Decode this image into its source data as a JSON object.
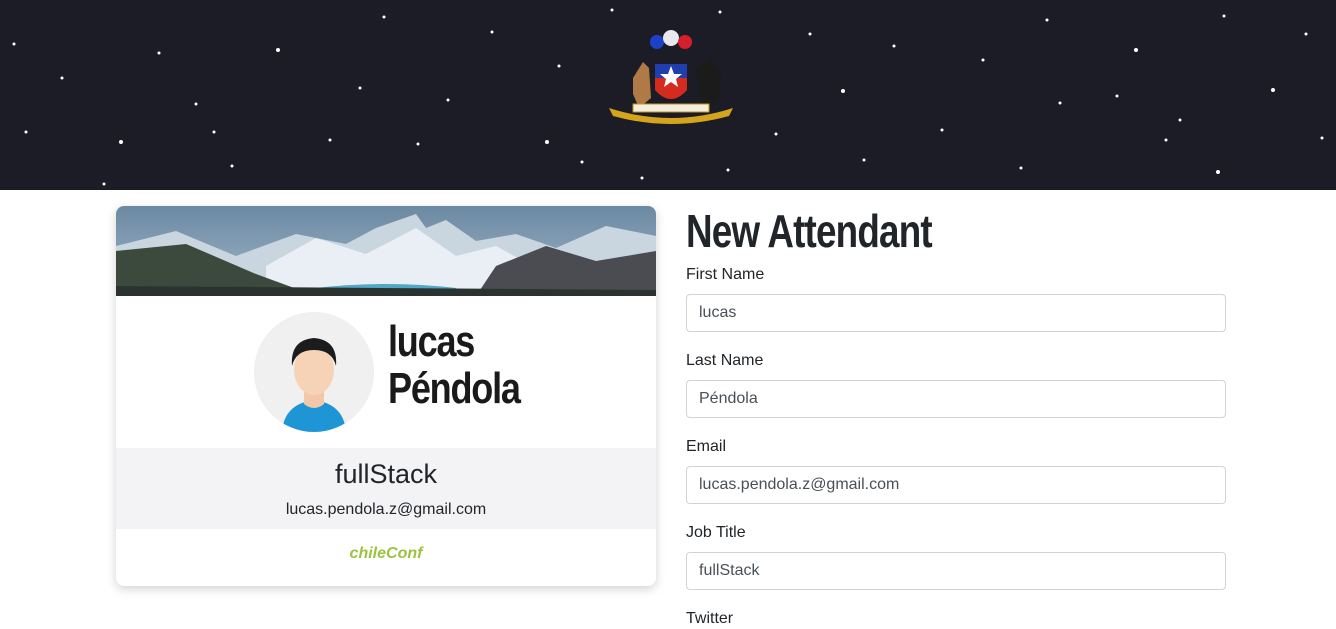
{
  "colors": {
    "header_bg": "#1c1c26",
    "event_accent": "#9ac440",
    "info_band": "#f3f3f5",
    "input_border": "#ced4da"
  },
  "header": {
    "logo_icon": "chile-coat-of-arms-icon"
  },
  "badge": {
    "banner_icon": "mountain-landscape-image",
    "avatar_icon": "user-avatar-icon",
    "first_name": "lucas",
    "last_name": "Péndola",
    "job_title": "fullStack",
    "email": "lucas.pendola.z@gmail.com",
    "event": "chileConf"
  },
  "form": {
    "title": "New Attendant",
    "fields": [
      {
        "label": "First Name",
        "value": "lucas"
      },
      {
        "label": "Last Name",
        "value": "Péndola"
      },
      {
        "label": "Email",
        "value": "lucas.pendola.z@gmail.com"
      },
      {
        "label": "Job Title",
        "value": "fullStack"
      },
      {
        "label": "Twitter",
        "value": ""
      }
    ]
  }
}
